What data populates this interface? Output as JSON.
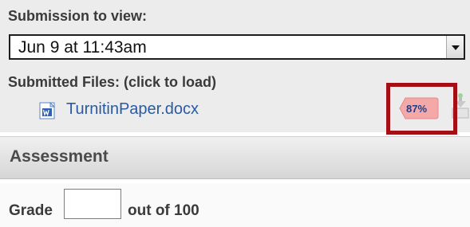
{
  "submission": {
    "label": "Submission to view:",
    "selected": "Jun 9 at 11:43am"
  },
  "files": {
    "label": "Submitted Files: (click to load)",
    "items": [
      {
        "name": "TurnitinPaper.docx",
        "icon": "word-doc-icon"
      }
    ]
  },
  "originality": {
    "score": "87%",
    "badge_color": "#f4a8a8",
    "highlight_color": "#a30f14"
  },
  "assessment": {
    "title": "Assessment",
    "grade_label": "Grade",
    "grade_value": "",
    "grade_suffix": "out of 100"
  }
}
